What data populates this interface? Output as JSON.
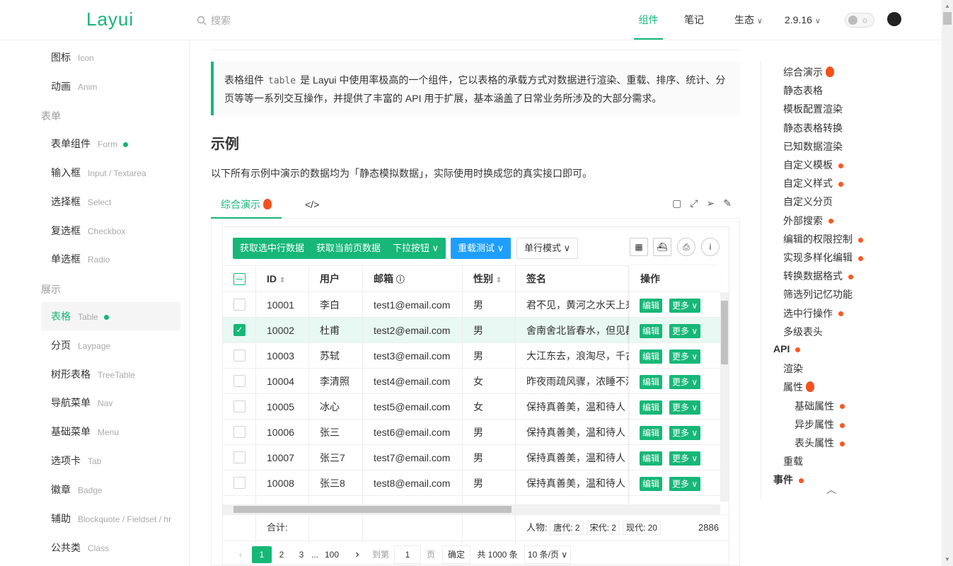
{
  "header": {
    "logo": "Layui",
    "search_placeholder": "搜索",
    "nav": [
      "组件",
      "笔记",
      "生态",
      "2.9.16"
    ],
    "chevron": "⌵"
  },
  "sidebar": {
    "items": [
      {
        "label": "图标",
        "en": "Icon"
      },
      {
        "label": "动画",
        "en": "Anim"
      }
    ],
    "group_form": "表单",
    "form_items": [
      {
        "label": "表单组件",
        "en": "Form",
        "dot": true
      },
      {
        "label": "输入框",
        "en": "Input / Textarea"
      },
      {
        "label": "选择框",
        "en": "Select"
      },
      {
        "label": "复选框",
        "en": "Checkbox"
      },
      {
        "label": "单选框",
        "en": "Radio"
      }
    ],
    "group_show": "展示",
    "show_items": [
      {
        "label": "表格",
        "en": "Table",
        "dot": true,
        "active": true
      },
      {
        "label": "分页",
        "en": "Laypage"
      },
      {
        "label": "树形表格",
        "en": "TreeTable"
      },
      {
        "label": "导航菜单",
        "en": "Nav"
      },
      {
        "label": "基础菜单",
        "en": "Menu"
      },
      {
        "label": "选项卡",
        "en": "Tab"
      },
      {
        "label": "徽章",
        "en": "Badge"
      },
      {
        "label": "辅助",
        "en": "Blockquote / Fieldset / hr"
      },
      {
        "label": "公共类",
        "en": "Class"
      }
    ]
  },
  "main": {
    "quote_a": "表格组件",
    "quote_code": "table",
    "quote_b": "是 Layui 中使用率极高的一个组件，它以表格的承载方式对数据进行渲染、重载、排序、统计、分页等等一系列交互操作，并提供了丰富的 API 用于扩展，基本涵盖了日常业务所涉及的大部分需求。",
    "h2": "示例",
    "para": "以下所有示例中演示的数据均为「静态模拟数据」，实际使用时换成您的真实接口即可。",
    "tab_demo": "综合演示",
    "tab_code": "</>"
  },
  "table": {
    "buttons": [
      "获取选中行数据",
      "获取当前页数据",
      "下拉按钮",
      "重载测试",
      "单行模式"
    ],
    "columns": [
      "ID",
      "用户",
      "邮箱",
      "性别",
      "签名",
      "操作"
    ],
    "rows": [
      {
        "id": "10001",
        "user": "李白",
        "email": "test1@email.com",
        "sex": "男",
        "sign": "君不见，黄河之水天上来",
        "checked": false
      },
      {
        "id": "10002",
        "user": "杜甫",
        "email": "test2@email.com",
        "sex": "男",
        "sign": "舍南舍北皆春水，但见群鸥",
        "checked": true
      },
      {
        "id": "10003",
        "user": "苏轼",
        "email": "test3@email.com",
        "sex": "男",
        "sign": "大江东去，浪淘尽，千古风",
        "checked": false
      },
      {
        "id": "10004",
        "user": "李清照",
        "email": "test4@email.com",
        "sex": "女",
        "sign": "昨夜雨疏风骤，浓睡不消残",
        "checked": false
      },
      {
        "id": "10005",
        "user": "冰心",
        "email": "test5@email.com",
        "sex": "女",
        "sign": "保持真善美，温和待人",
        "checked": false
      },
      {
        "id": "10006",
        "user": "张三",
        "email": "test6@email.com",
        "sex": "男",
        "sign": "保持真善美，温和待人",
        "checked": false
      },
      {
        "id": "10007",
        "user": "张三7",
        "email": "test7@email.com",
        "sex": "男",
        "sign": "保持真善美，温和待人",
        "checked": false
      },
      {
        "id": "10008",
        "user": "张三8",
        "email": "test8@email.com",
        "sex": "男",
        "sign": "保持真善美，温和待人",
        "checked": false
      }
    ],
    "edit_label": "编辑",
    "more_label": "更多",
    "total_label": "合计:",
    "total_people": "人物:",
    "tags": [
      "唐代: 2",
      "宋代: 2",
      "现代: 20"
    ],
    "total_num": "2886",
    "pager": {
      "pages": [
        "1",
        "2",
        "3",
        "...",
        "100"
      ],
      "goto": "到第",
      "goto_val": "1",
      "page_unit": "页",
      "confirm": "确定",
      "count": "共 1000 条",
      "limit": "10 条/页"
    }
  },
  "toc": [
    {
      "label": "综合演示",
      "mark": "flame",
      "level": 2
    },
    {
      "label": "静态表格",
      "level": 2
    },
    {
      "label": "模板配置渲染",
      "level": 2
    },
    {
      "label": "静态表格转换",
      "level": 2
    },
    {
      "label": "已知数据渲染",
      "level": 2
    },
    {
      "label": "自定义模板",
      "mark": "dot",
      "level": 2
    },
    {
      "label": "自定义样式",
      "mark": "dot",
      "level": 2
    },
    {
      "label": "自定义分页",
      "level": 2
    },
    {
      "label": "外部搜索",
      "mark": "dot",
      "level": 2
    },
    {
      "label": "编辑的权限控制",
      "mark": "dot",
      "level": 2
    },
    {
      "label": "实现多样化编辑",
      "mark": "dot",
      "level": 2
    },
    {
      "label": "转换数据格式",
      "mark": "dot",
      "level": 2
    },
    {
      "label": "筛选列记忆功能",
      "level": 2
    },
    {
      "label": "选中行操作",
      "mark": "dot",
      "level": 2
    },
    {
      "label": "多级表头",
      "level": 2
    },
    {
      "label": "API",
      "mark": "dot",
      "level": 1
    },
    {
      "label": "渲染",
      "level": 2
    },
    {
      "label": "属性",
      "mark": "flame",
      "level": 2
    },
    {
      "label": "基础属性",
      "mark": "dot",
      "level": 3
    },
    {
      "label": "异步属性",
      "mark": "dot",
      "level": 3
    },
    {
      "label": "表头属性",
      "mark": "dot",
      "level": 3
    },
    {
      "label": "重载",
      "level": 2
    },
    {
      "label": "事件",
      "mark": "dot",
      "level": 1
    }
  ],
  "colors": {
    "accent": "#16b777",
    "blue": "#1e9fff",
    "dot": "#ff5722"
  }
}
